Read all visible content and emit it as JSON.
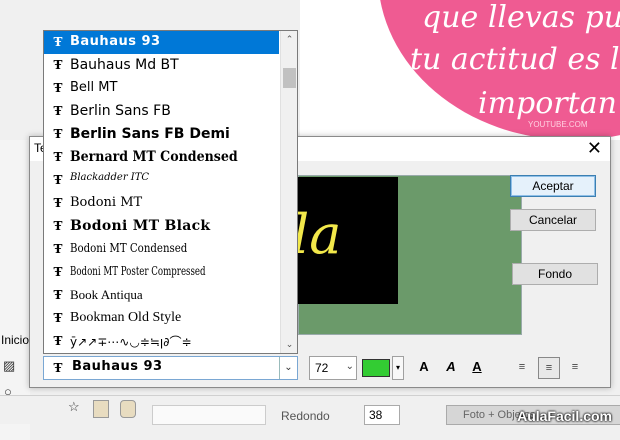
{
  "background": {
    "script_lines": [
      "que llevas pu",
      "tu actitud es la",
      "importan"
    ],
    "watermark_small": "YOUTUBE.COM",
    "left_tab": "Inicio",
    "bottom": {
      "redondo_label": "Redondo",
      "redondo_value": "38",
      "photo_button": "Foto + Objetos",
      "brand": "AulaFacil.com"
    }
  },
  "dialog": {
    "title": "Te",
    "close_glyph": "✕",
    "preview_text": "la",
    "buttons": {
      "ok": "Aceptar",
      "cancel": "Cancelar",
      "background": "Fondo"
    },
    "font_selected": "Bauhaus 93",
    "font_size": "72",
    "text_color": "#33cc33",
    "format_buttons": [
      "A",
      "A",
      "A"
    ]
  },
  "font_list": {
    "items": [
      "Bauhaus 93",
      "Bauhaus Md BT",
      "Bell MT",
      "Berlin Sans FB",
      "Berlin Sans FB Demi",
      "Bernard MT Condensed",
      "Blackadder ITC",
      "Bodoni MT",
      "Bodoni MT Black",
      "Bodoni MT Condensed",
      "Bodoni MT Poster Compressed",
      "Book Antiqua",
      "Bookman Old Style",
      "ȳ↗↗∓⋯∿◡≑≒ꞁ∂⌒≑"
    ],
    "selected_index": 0
  },
  "icons": {
    "truetype": "Ŧ",
    "dropdown": "⌄",
    "scroll_up": "⌃",
    "scroll_down": "⌄"
  }
}
